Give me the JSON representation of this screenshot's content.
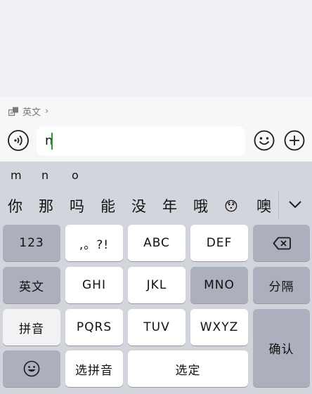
{
  "translate": {
    "label": "英文",
    "arrow": "›",
    "icon": "translate-icon"
  },
  "input": {
    "value": "n"
  },
  "pinyin_options": [
    "m",
    "n",
    "o"
  ],
  "candidates": [
    "你",
    "那",
    "吗",
    "能",
    "没",
    "年",
    "哦",
    "😯",
    "噢"
  ],
  "keys": {
    "num": "123",
    "punct": ",。?!",
    "abc": "ABC",
    "def": "DEF",
    "english": "英文",
    "ghi": "GHI",
    "jkl": "JKL",
    "mno": "MNO",
    "segment": "分隔",
    "pinyin": "拼音",
    "pqrs": "PQRS",
    "tuv": "TUV",
    "wxyz": "WXYZ",
    "confirm": "确认",
    "select_pinyin": "选拼音",
    "select": "选定"
  },
  "colors": {
    "accent": "#1aad19",
    "key_light": "#ffffff",
    "key_dark": "#abb0bc",
    "keyboard_bg": "#d2d5db"
  }
}
